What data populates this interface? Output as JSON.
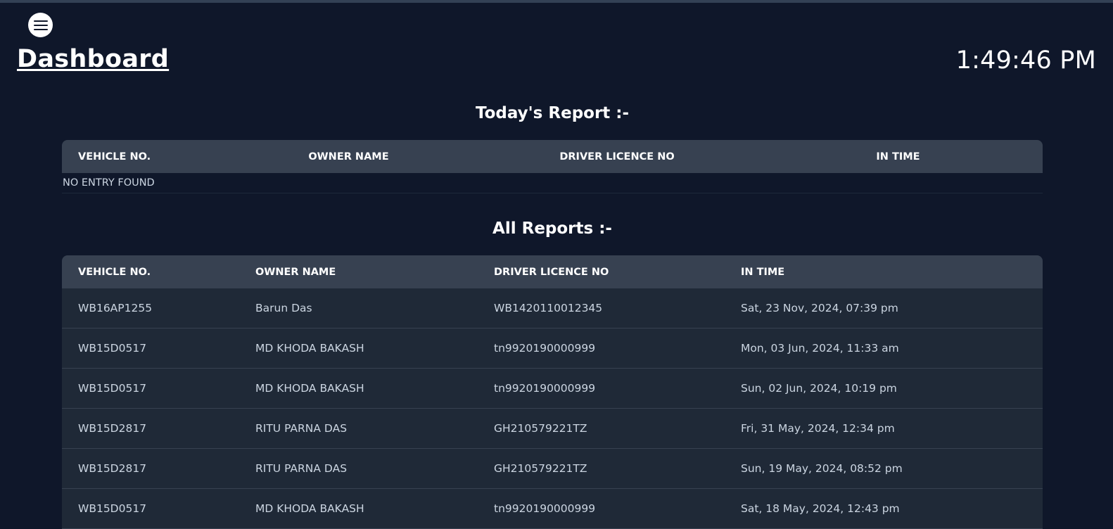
{
  "header": {
    "title": "Dashboard",
    "clock": "1:49:46 PM",
    "menu_icon": "hamburger-icon"
  },
  "today": {
    "heading": "Today's Report :-",
    "columns": [
      "VEHICLE NO.",
      "OWNER NAME",
      "DRIVER LICENCE NO",
      "IN TIME"
    ],
    "empty_text": "NO ENTRY FOUND"
  },
  "all": {
    "heading": "All Reports :-",
    "columns": [
      "VEHICLE NO.",
      "OWNER NAME",
      "DRIVER LICENCE NO",
      "IN TIME"
    ],
    "rows": [
      [
        "WB16AP1255",
        "Barun Das",
        "WB1420110012345",
        "Sat, 23 Nov, 2024, 07:39 pm"
      ],
      [
        "WB15D0517",
        "MD KHODA BAKASH",
        "tn9920190000999",
        "Mon, 03 Jun, 2024, 11:33 am"
      ],
      [
        "WB15D0517",
        "MD KHODA BAKASH",
        "tn9920190000999",
        "Sun, 02 Jun, 2024, 10:19 pm"
      ],
      [
        "WB15D2817",
        "RITU PARNA DAS",
        "GH210579221TZ",
        "Fri, 31 May, 2024, 12:34 pm"
      ],
      [
        "WB15D2817",
        "RITU PARNA DAS",
        "GH210579221TZ",
        "Sun, 19 May, 2024, 08:52 pm"
      ],
      [
        "WB15D0517",
        "MD KHODA BAKASH",
        "tn9920190000999",
        "Sat, 18 May, 2024, 12:43 pm"
      ]
    ]
  }
}
